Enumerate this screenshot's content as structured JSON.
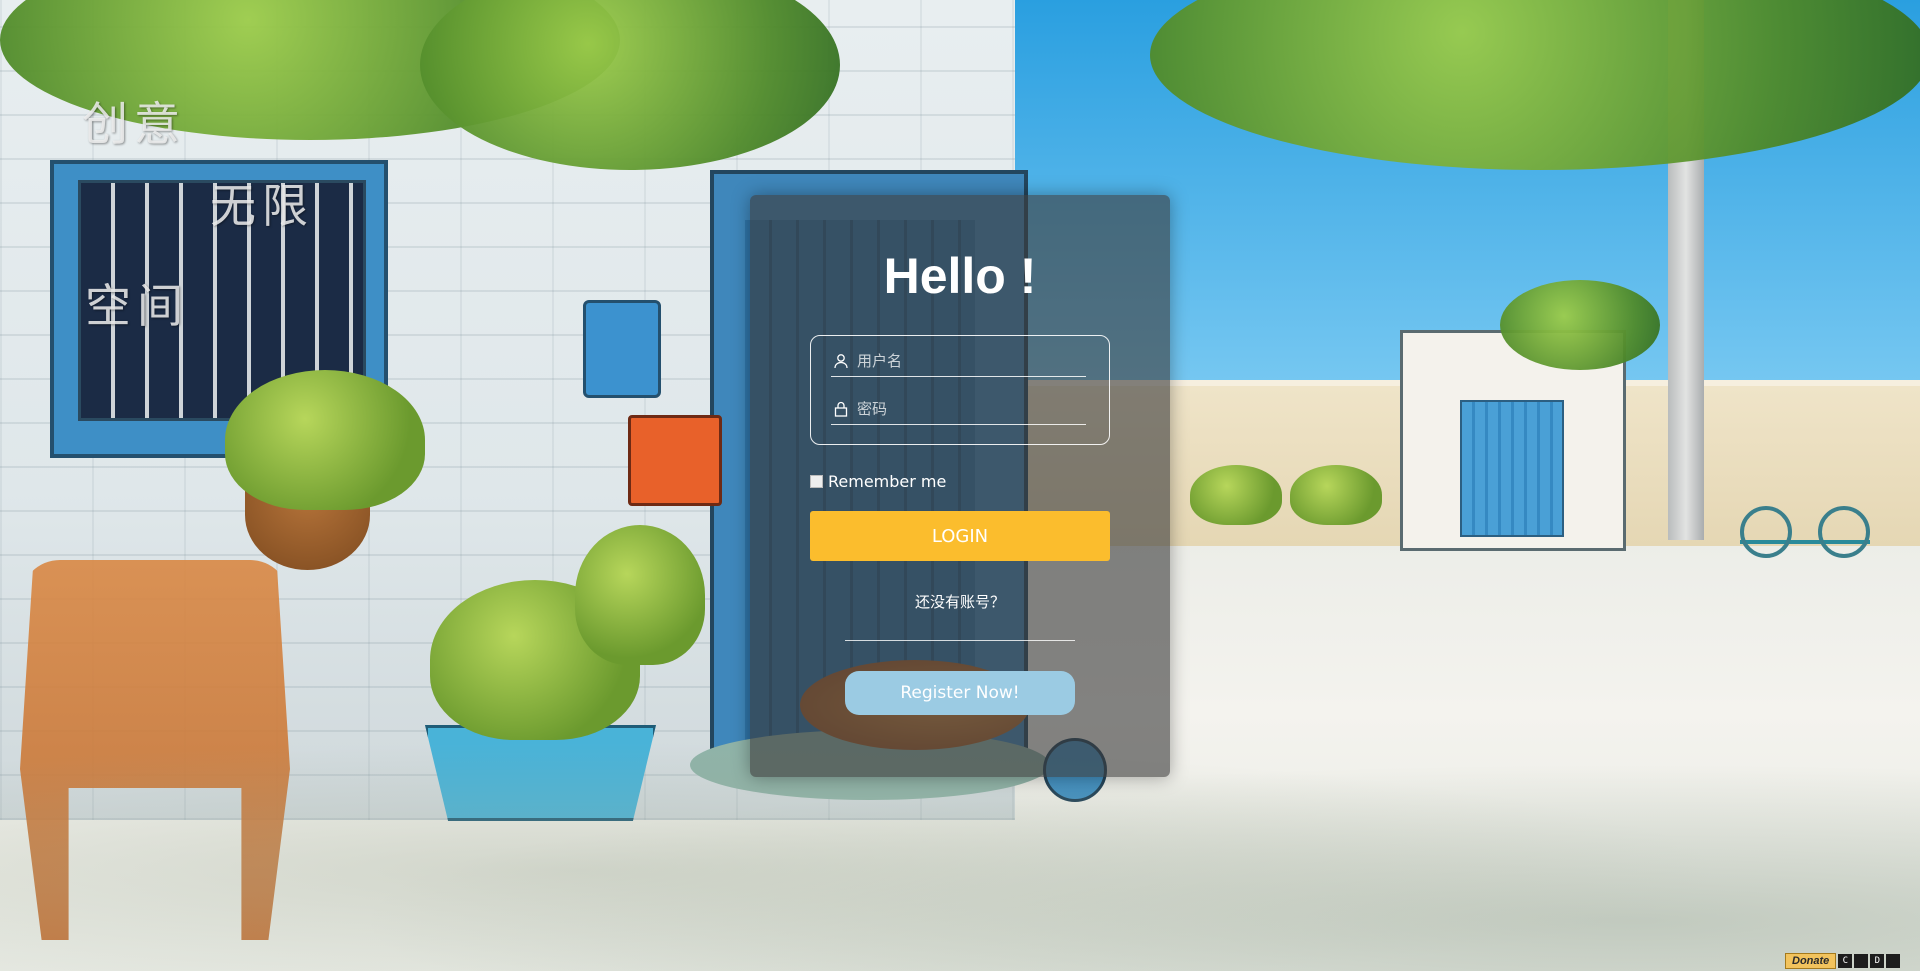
{
  "motto": {
    "line1": "创意",
    "line2": "无限",
    "line3": "空间"
  },
  "login": {
    "title": "Hello !",
    "username_placeholder": "用户名",
    "password_placeholder": "密码",
    "remember_label": "Remember me",
    "login_button": "LOGIN",
    "no_account_text": "还没有账号？",
    "register_button": "Register Now!"
  },
  "widget": {
    "donate_label": "Donate",
    "buttons": [
      "C",
      "",
      "D",
      ""
    ]
  },
  "colors": {
    "login_button": "#fbbd2d",
    "register_button": "#9bcbe3",
    "panel": "rgba(60,60,60,0.62)"
  },
  "icons": {
    "username": "user-icon",
    "password": "lock-icon"
  }
}
